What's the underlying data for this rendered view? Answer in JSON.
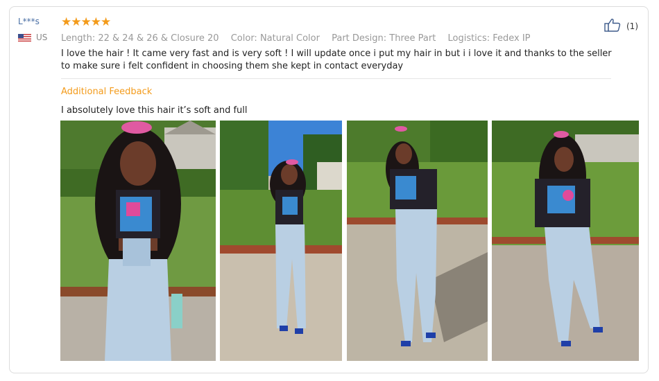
{
  "reviewer": {
    "name": "L***s",
    "country": "US",
    "flag_icon": "us-flag-icon"
  },
  "rating": {
    "stars": "★★★★★",
    "value": 5,
    "max": 5,
    "color": "#f39b1b"
  },
  "attributes": [
    "Length: 22 & 24 & 26 & Closure 20",
    "Color: Natural Color",
    "Part Design: Three Part",
    "Logistics: Fedex IP"
  ],
  "review_text": "I love the hair ! It came very fast and is very soft ! I will update once i put my hair in but i i love it and thanks to the seller to make sure i felt confident in choosing them she kept in contact everyday",
  "additional_feedback": {
    "title": "Additional Feedback",
    "text": "I absolutely love this hair it’s soft and full"
  },
  "helpful": {
    "count_label": "(1)",
    "icon": "thumbs-up-icon"
  },
  "photos": [
    {
      "name": "review-photo-1",
      "scene": "garden"
    },
    {
      "name": "review-photo-2",
      "scene": "sidewalk-sky"
    },
    {
      "name": "review-photo-3",
      "scene": "sidewalk-trees"
    },
    {
      "name": "review-photo-4",
      "scene": "lawn"
    }
  ]
}
